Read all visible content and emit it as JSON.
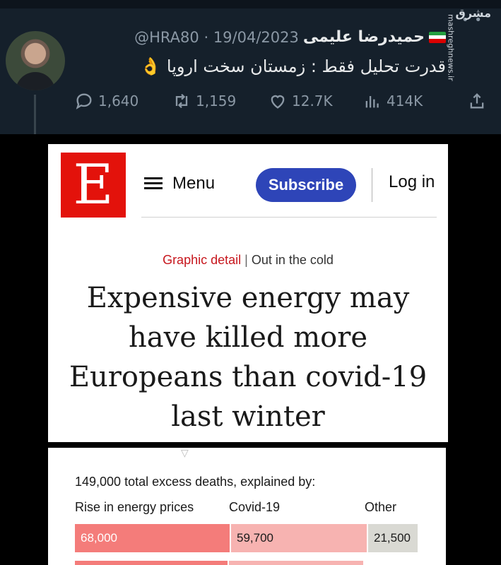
{
  "tweet": {
    "display_name": "حمیدرضا علیمی",
    "handle": "@HRA80",
    "separator": "·",
    "date": "19/04/2023",
    "text": "قدرت تحلیل فقط : زمستان سخت اروپا",
    "emoji": "👌",
    "flag": "iran-flag",
    "actions": {
      "replies": "1,640",
      "retweets": "1,159",
      "likes": "12.7K",
      "views": "414K"
    },
    "icons": [
      "reply-icon",
      "retweet-icon",
      "like-icon",
      "views-icon",
      "share-icon",
      "more-icon"
    ]
  },
  "watermark": {
    "logo": "مشرق",
    "site": "mashreghnews.ir"
  },
  "article": {
    "logo_letter": "E",
    "menu_label": "Menu",
    "subscribe_label": "Subscribe",
    "login_label": "Log in",
    "kicker_section": "Graphic detail",
    "kicker_sep": "|",
    "kicker_topic": "Out in the cold",
    "headline": "Expensive energy may have killed more Europeans than covid-19 last winter"
  },
  "colors": {
    "tweet_bg": "#15202b",
    "economist_red": "#e3120b",
    "subscribe_blue": "#2e45b8",
    "energy_bar": "#f47c7a",
    "covid_bar": "#f7b3b1",
    "other_bar": "#d9d9d3"
  },
  "chart_data": {
    "type": "bar",
    "title": "149,000 total excess deaths, explained by:",
    "categories": [
      "Rise in energy prices",
      "Covid-19",
      "Other"
    ],
    "values": [
      68000,
      59700,
      21500
    ],
    "value_labels": [
      "68,000",
      "59,700",
      "21,500"
    ],
    "total": 149000
  }
}
